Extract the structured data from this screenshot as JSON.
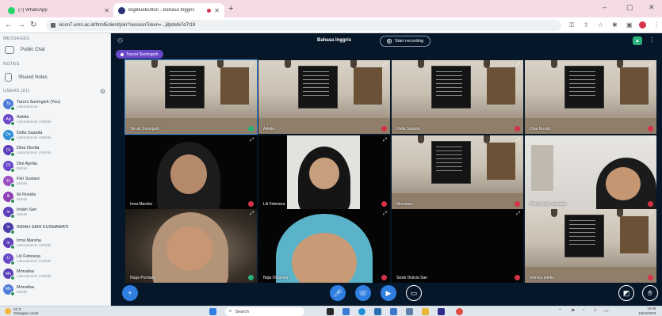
{
  "browser": {
    "tabs": [
      {
        "label": "(7) WhatsApp",
        "active": false,
        "icon": "whatsapp-icon",
        "color": "#25d366"
      },
      {
        "label": "BigBlueButton - Bahasa Inggris",
        "active": true,
        "icon": "bigbluebutton-icon",
        "color": "#283274"
      }
    ],
    "new_tab": "+",
    "url": "vicon7.umri.ac.id/html5client/join?sessionToken=...j8jtdefe7d7t19",
    "win_controls": [
      "–",
      "▢",
      "✕"
    ]
  },
  "sidebar": {
    "messages_label": "MESSAGES",
    "public_chat": "Public Chat",
    "notes_label": "NOTES",
    "shared_notes": "Shared Notes",
    "users_label": "USERS (21)",
    "users": [
      {
        "initials": "Ta",
        "name": "Taruni Suningsih (You)",
        "sub": "Laboratorium",
        "color": "#4f7bd8",
        "presenter": true
      },
      {
        "initials": "Ad",
        "name": "Adelia",
        "sub": "Laboratorium | Mobile",
        "color": "#6a48c9"
      },
      {
        "initials": "De",
        "name": "Della Saspita",
        "sub": "Laboratorium | Mobile",
        "color": "#2f8fd6"
      },
      {
        "initials": "Di",
        "name": "Dina Novita",
        "sub": "Laboratorium | Mobile",
        "color": "#5b3fb8"
      },
      {
        "initials": "Di",
        "name": "Dini Aprilia",
        "sub": "Mobile",
        "color": "#6a48c9"
      },
      {
        "initials": "Fi",
        "name": "Fitri Susiani",
        "sub": "Mobile",
        "color": "#9a4fc2"
      },
      {
        "initials": "Ik",
        "name": "Iki Rosida",
        "sub": "Mobile",
        "color": "#8e3fb3"
      },
      {
        "initials": "In",
        "name": "Indah Sari",
        "sub": "Mobile",
        "color": "#5b3fb8"
      },
      {
        "initials": "In",
        "name": "INDAH SARI KUSMAWATI",
        "sub": "",
        "color": "#4a3aa8"
      },
      {
        "initials": "In",
        "name": "Irma Marsha",
        "sub": "Laboratorium | Mobile",
        "color": "#5b3fb8"
      },
      {
        "initials": "Li",
        "name": "Lili Febriana",
        "sub": "Laboratorium | Mobile",
        "color": "#6a48c9"
      },
      {
        "initials": "Mo",
        "name": "Monalisa",
        "sub": "Laboratorium | Mobile",
        "color": "#5b3fb8"
      },
      {
        "initials": "Mo",
        "name": "Monalisa",
        "sub": "Mobile",
        "color": "#4f7bd8"
      }
    ]
  },
  "meeting": {
    "title": "Bahasa Inggris",
    "record_label": "Start recording",
    "talking_indicator": "Taruni Suningsih",
    "tiles": [
      {
        "name": "Taruni Suningsih",
        "scene": "cafe",
        "mic": "on",
        "active": true
      },
      {
        "name": "Adelia",
        "scene": "cafe",
        "mic": "muted"
      },
      {
        "name": "Della Saspita",
        "scene": "cafe",
        "mic": "muted"
      },
      {
        "name": "Dina Novita",
        "scene": "cafe",
        "mic": "muted"
      },
      {
        "name": "Irma Marsha",
        "scene": "dark-person",
        "mic": "muted"
      },
      {
        "name": "Lili Febriana",
        "scene": "wall-person",
        "mic": "muted"
      },
      {
        "name": "Monalisa",
        "scene": "cafe",
        "mic": "muted"
      },
      {
        "name": "Fitria Lasfia Yumaida",
        "scene": "blur-person",
        "mic": "muted"
      },
      {
        "name": "Nuga Purnada",
        "scene": "blur-person2",
        "mic": "on"
      },
      {
        "name": "Nuja Oktavina",
        "scene": "close-person",
        "mic": "muted"
      },
      {
        "name": "Seski Diulvia Sari",
        "scene": "dark",
        "mic": "muted"
      },
      {
        "name": "monica adelia",
        "scene": "cafe",
        "mic": "muted"
      }
    ]
  },
  "taskbar": {
    "temp": "31°C",
    "weather_desc": "Sebagian cerah",
    "search_label": "Search",
    "time": "10:46",
    "date": "13/04/2023"
  }
}
